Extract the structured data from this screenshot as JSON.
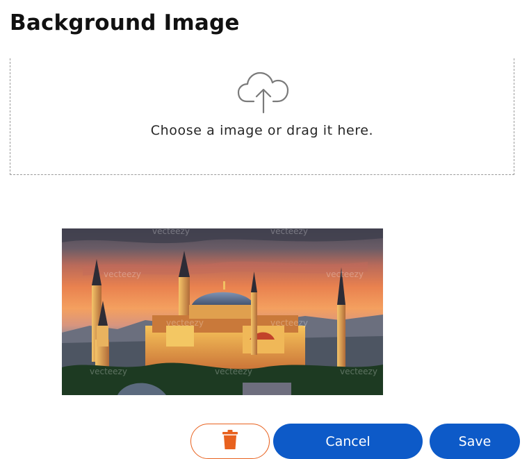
{
  "header": {
    "title": "Background Image"
  },
  "dropzone": {
    "icon": "cloud-upload-icon",
    "text": "Choose a image or drag it here."
  },
  "preview": {
    "image": "mosque-at-sunset-photo",
    "watermark": "vecteezy"
  },
  "actions": {
    "delete_icon": "trash-icon",
    "cancel_label": "Cancel",
    "save_label": "Save"
  },
  "colors": {
    "primary": "#0d5ac8",
    "danger": "#e8611e",
    "dropzone_border": "#9a9a9a"
  }
}
